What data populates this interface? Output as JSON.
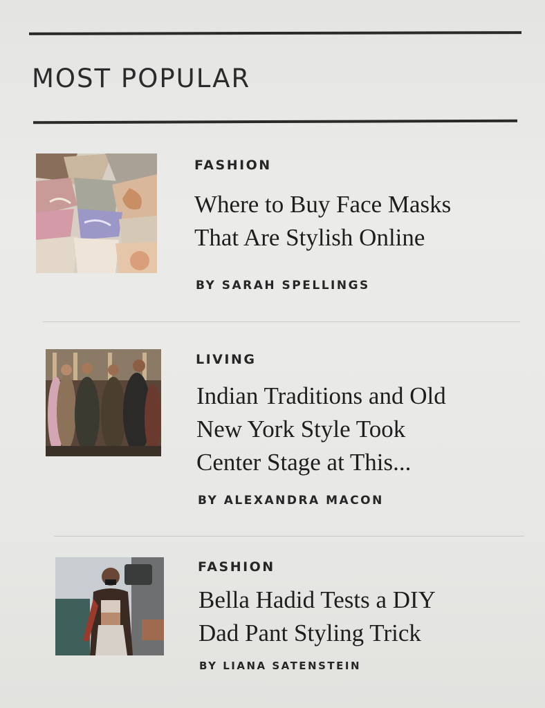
{
  "section": {
    "title": "MOST POPULAR"
  },
  "articles": [
    {
      "category": "FASHION",
      "title_lines": [
        "Where to Buy Face Masks",
        "That Are Stylish Online"
      ],
      "byline": "BY SARAH SPELLINGS",
      "image_subject": "pile of fabric face masks"
    },
    {
      "category": "LIVING",
      "title_lines": [
        "Indian Traditions and Old",
        "New York Style Took",
        "Center Stage at This..."
      ],
      "byline": "BY ALEXANDRA MACON",
      "image_subject": "group of people at a wedding celebration"
    },
    {
      "category": "FASHION",
      "title_lines": [
        "Bella Hadid Tests a DIY",
        "Dad Pant Styling Trick"
      ],
      "byline": "BY LIANA SATENSTEIN",
      "image_subject": "woman wearing face mask on street"
    }
  ]
}
